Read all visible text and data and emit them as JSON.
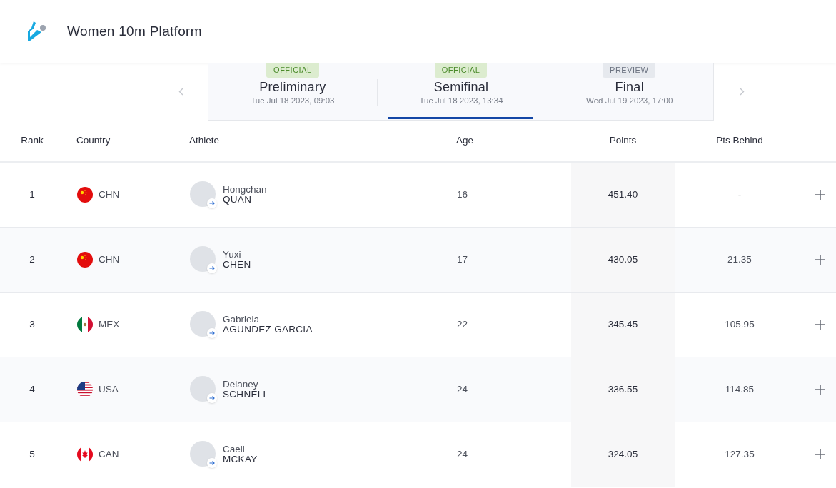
{
  "header": {
    "title": "Women 10m Platform"
  },
  "phases": [
    {
      "kind": "official",
      "badge": "OFFICIAL",
      "name": "Preliminary",
      "date": "Tue Jul 18 2023, 09:03",
      "selected": false
    },
    {
      "kind": "official",
      "badge": "OFFICIAL",
      "name": "Semifinal",
      "date": "Tue Jul 18 2023, 13:34",
      "selected": true
    },
    {
      "kind": "preview",
      "badge": "PREVIEW",
      "name": "Final",
      "date": "Wed Jul 19 2023, 17:00",
      "selected": false
    }
  ],
  "table": {
    "columns": [
      "Rank",
      "Country",
      "Athlete",
      "Age",
      "Points",
      "Pts Behind"
    ],
    "rows": [
      {
        "rank": "1",
        "flag": {
          "kind": "cn"
        },
        "country": "CHN",
        "first_name": "Hongchan",
        "last_name": "QUAN",
        "age": "16",
        "points": "451.40",
        "behind": "-"
      },
      {
        "rank": "2",
        "flag": {
          "kind": "cn"
        },
        "country": "CHN",
        "first_name": "Yuxi",
        "last_name": "CHEN",
        "age": "17",
        "points": "430.05",
        "behind": "21.35"
      },
      {
        "rank": "3",
        "flag": {
          "kind": "mx"
        },
        "country": "MEX",
        "first_name": "Gabriela",
        "last_name": "AGUNDEZ GARCIA",
        "age": "22",
        "points": "345.45",
        "behind": "105.95"
      },
      {
        "rank": "4",
        "flag": {
          "kind": "us"
        },
        "country": "USA",
        "first_name": "Delaney",
        "last_name": "SCHNELL",
        "age": "24",
        "points": "336.55",
        "behind": "114.85"
      },
      {
        "rank": "5",
        "flag": {
          "kind": "ca"
        },
        "country": "CAN",
        "first_name": "Caeli",
        "last_name": "MCKAY",
        "age": "24",
        "points": "324.05",
        "behind": "127.35"
      }
    ]
  }
}
